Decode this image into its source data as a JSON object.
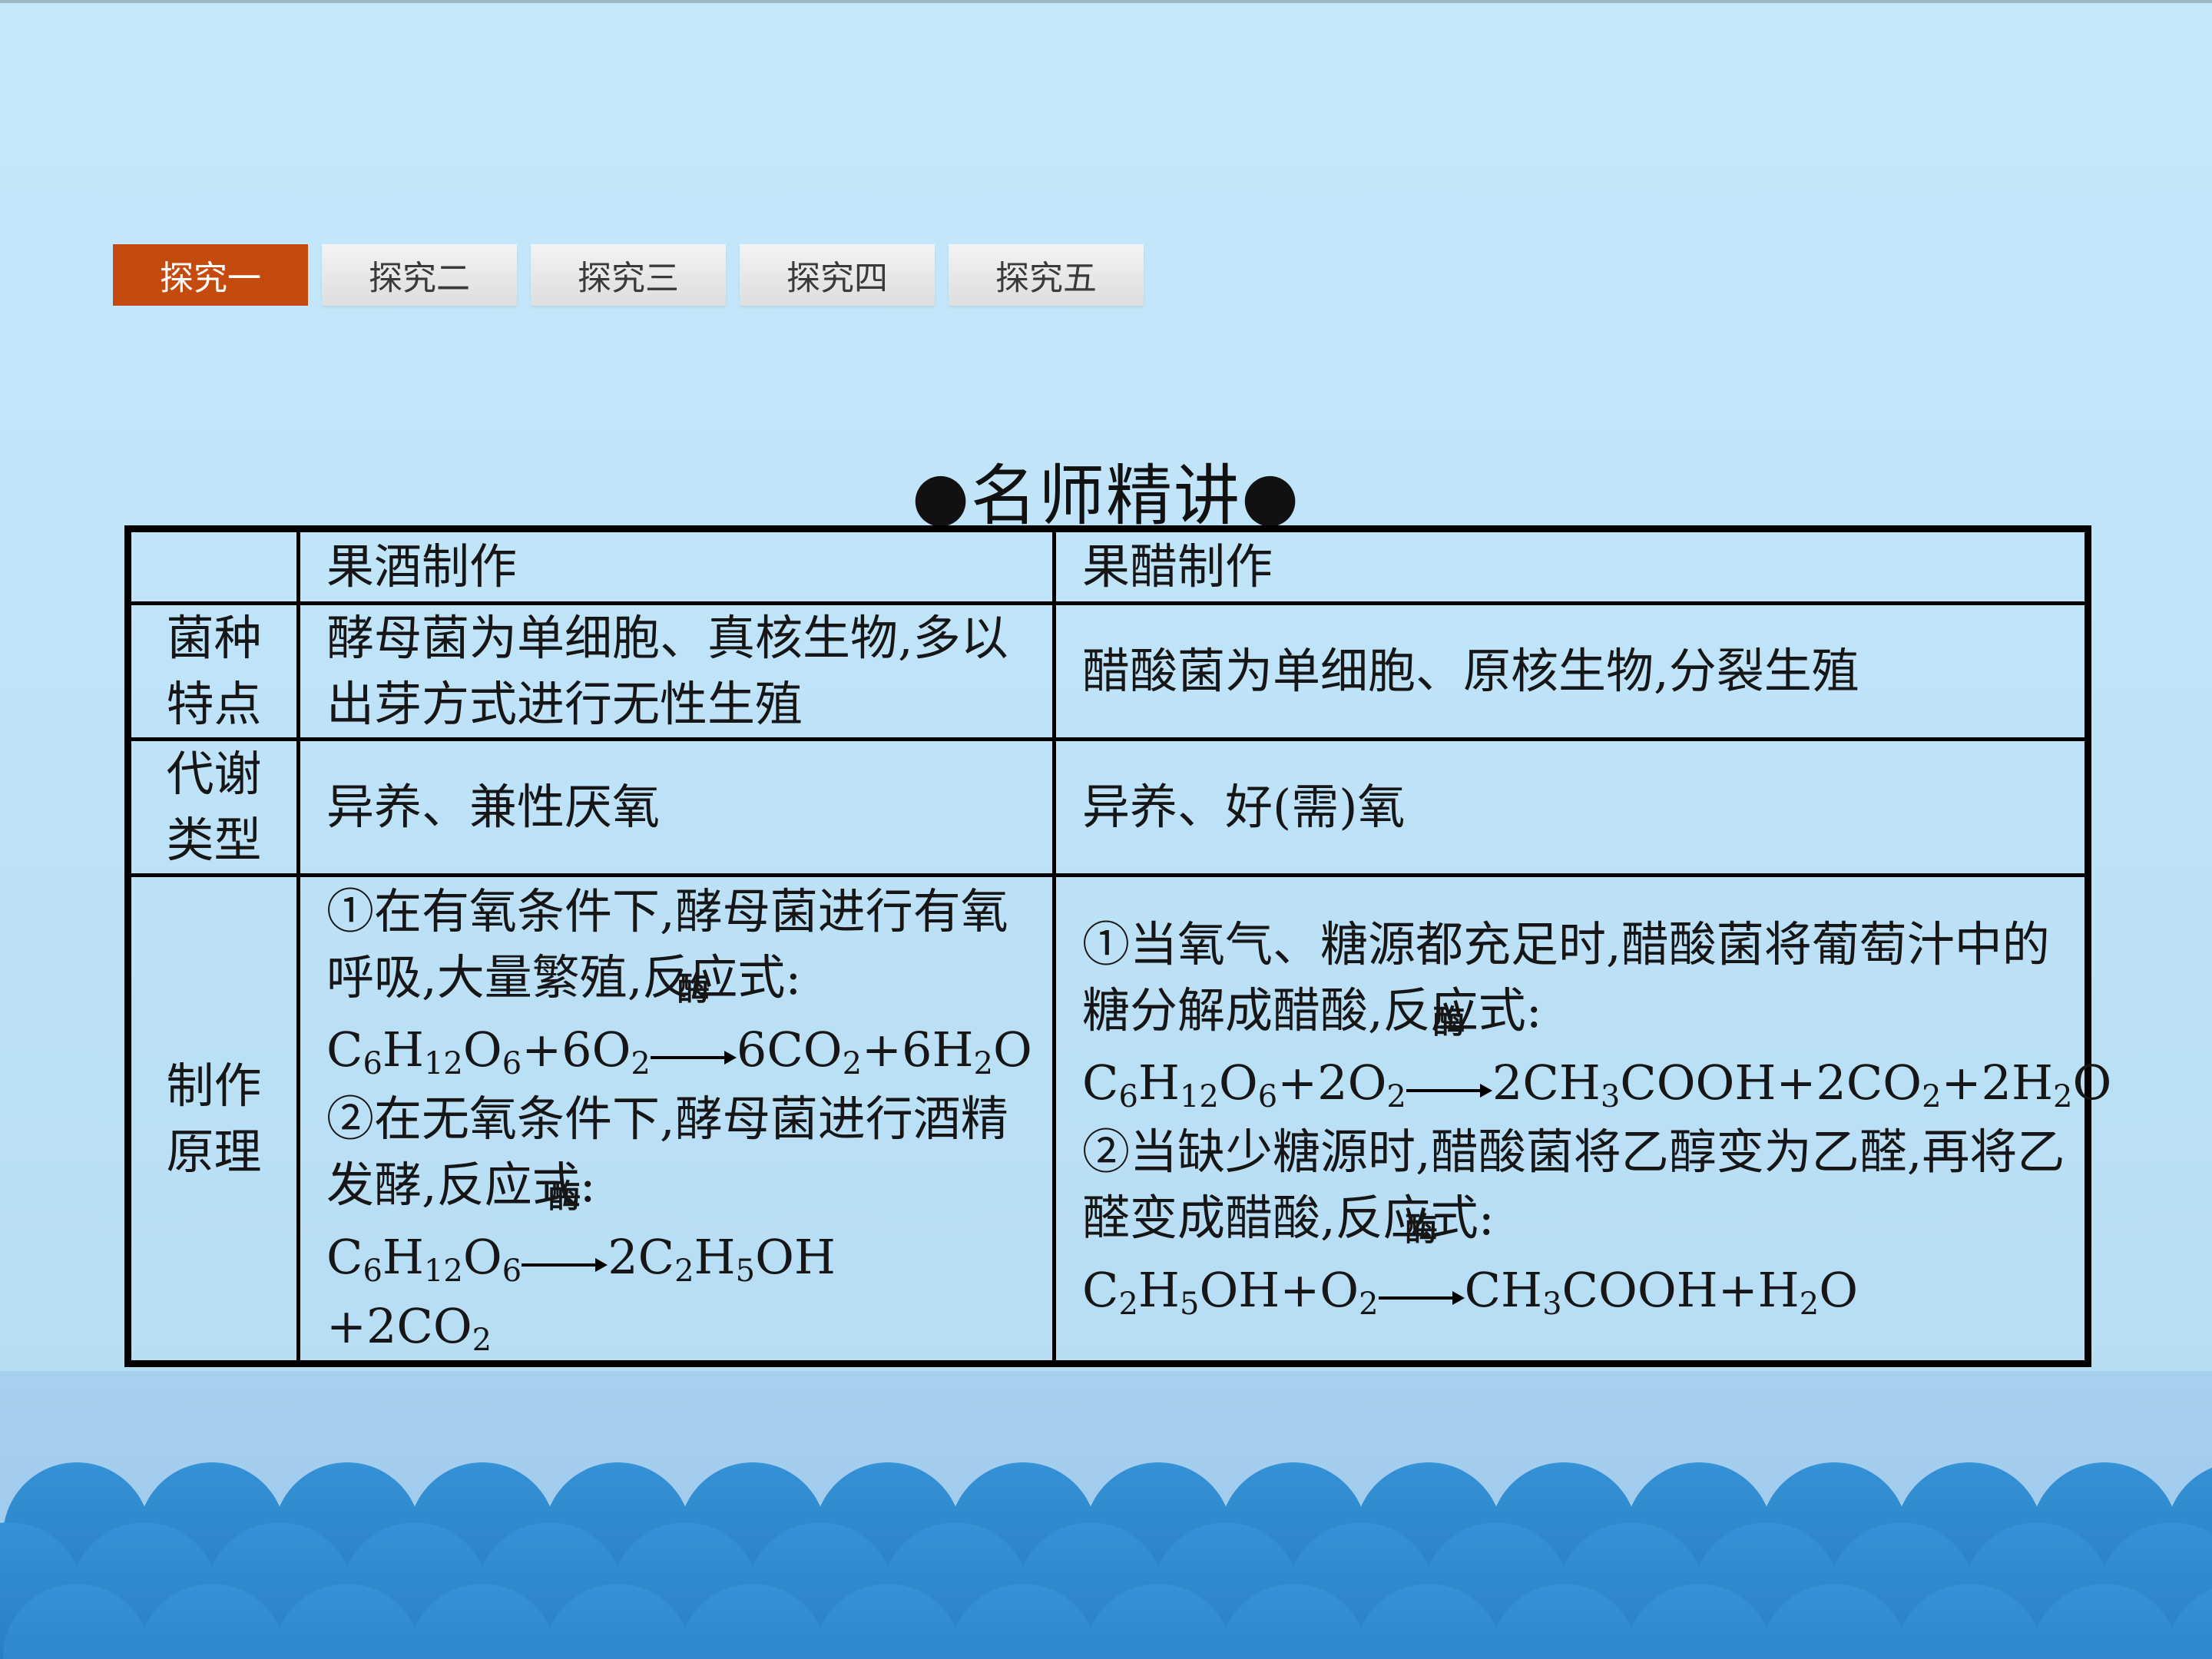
{
  "tabs": [
    {
      "label": "探究一",
      "active": true
    },
    {
      "label": "探究二",
      "active": false
    },
    {
      "label": "探究三",
      "active": false
    },
    {
      "label": "探究四",
      "active": false
    },
    {
      "label": "探究五",
      "active": false
    }
  ],
  "heading": "●名师精讲●",
  "table": {
    "col_headers": [
      "",
      "果酒制作",
      "果醋制作"
    ],
    "rows": [
      {
        "label": "菌种特点",
        "wine": "酵母菌为单细胞、真核生物,多以出芽方式进行无性生殖",
        "vinegar": "醋酸菌为单细胞、原核生物,分裂生殖"
      },
      {
        "label": "代谢类型",
        "wine": "异养、兼性厌氧",
        "vinegar": "异养、好(需)氧"
      },
      {
        "label": "制作原理",
        "wine": {
          "p1": "①在有氧条件下,酵母菌进行有氧呼吸,大量繁殖,反应式:",
          "eq1": "C6H12O6+6O2 →(酶) 6CO2+6H2O",
          "p2": "②在无氧条件下,酵母菌进行酒精发酵,反应式:",
          "eq2": "C6H12O6 →(酶) 2C2H5OH +2CO2"
        },
        "vinegar": {
          "p1": "①当氧气、糖源都充足时,醋酸菌将葡萄汁中的糖分解成醋酸,反应式:",
          "eq1": "C6H12O6+2O2 →(酶) 2CH3COOH+2CO2+2H2O",
          "p2": "②当缺少糖源时,醋酸菌将乙醇变为乙醛,再将乙醛变成醋酸,反应式:",
          "eq2": "C2H5OH+O2 →(酶) CH3COOH+H2O"
        }
      }
    ],
    "enzyme_label": "酶"
  },
  "colors": {
    "tab_active": "#c44a0e",
    "background": "#c6e8fb",
    "wave": "#2f86cc"
  }
}
